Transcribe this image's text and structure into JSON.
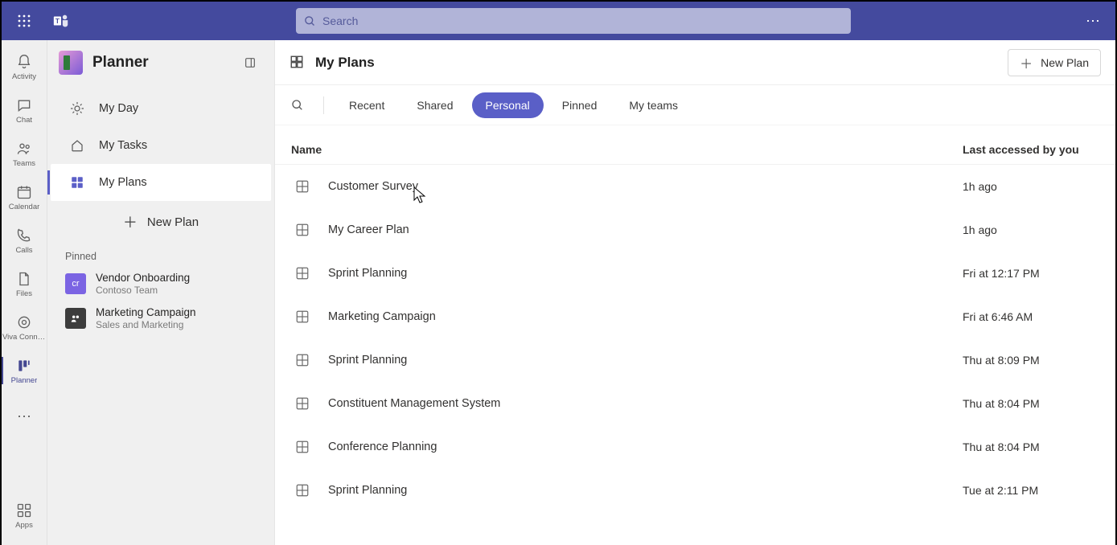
{
  "search": {
    "placeholder": "Search"
  },
  "rail": {
    "items": [
      {
        "label": "Activity"
      },
      {
        "label": "Chat"
      },
      {
        "label": "Teams"
      },
      {
        "label": "Calendar"
      },
      {
        "label": "Calls"
      },
      {
        "label": "Files"
      },
      {
        "label": "Viva Connec..."
      },
      {
        "label": "Planner"
      }
    ],
    "apps_label": "Apps"
  },
  "sidebar": {
    "app_title": "Planner",
    "items": [
      {
        "label": "My Day"
      },
      {
        "label": "My Tasks"
      },
      {
        "label": "My Plans"
      }
    ],
    "new_plan_label": "New Plan",
    "pinned_heading": "Pinned",
    "pinned": [
      {
        "title": "Vendor Onboarding",
        "subtitle": "Contoso Team",
        "color": "#7b64e3",
        "initials": "cr"
      },
      {
        "title": "Marketing Campaign",
        "subtitle": "Sales and Marketing",
        "color": "#3c3c3c",
        "initials": ""
      }
    ]
  },
  "content": {
    "page_title": "My Plans",
    "new_plan_button": "New Plan",
    "tabs": [
      {
        "label": "Recent",
        "active": false
      },
      {
        "label": "Shared",
        "active": false
      },
      {
        "label": "Personal",
        "active": true
      },
      {
        "label": "Pinned",
        "active": false
      },
      {
        "label": "My teams",
        "active": false
      }
    ],
    "columns": {
      "name": "Name",
      "accessed": "Last accessed by you"
    },
    "rows": [
      {
        "name": "Customer Survey",
        "time": "1h ago"
      },
      {
        "name": "My Career Plan",
        "time": "1h ago"
      },
      {
        "name": "Sprint Planning",
        "time": "Fri at 12:17 PM"
      },
      {
        "name": "Marketing Campaign",
        "time": "Fri at 6:46 AM"
      },
      {
        "name": "Sprint Planning",
        "time": "Thu at 8:09 PM"
      },
      {
        "name": "Constituent Management System",
        "time": "Thu at 8:04 PM"
      },
      {
        "name": "Conference Planning",
        "time": "Thu at 8:04 PM"
      },
      {
        "name": "Sprint Planning",
        "time": "Tue at 2:11 PM"
      }
    ]
  }
}
